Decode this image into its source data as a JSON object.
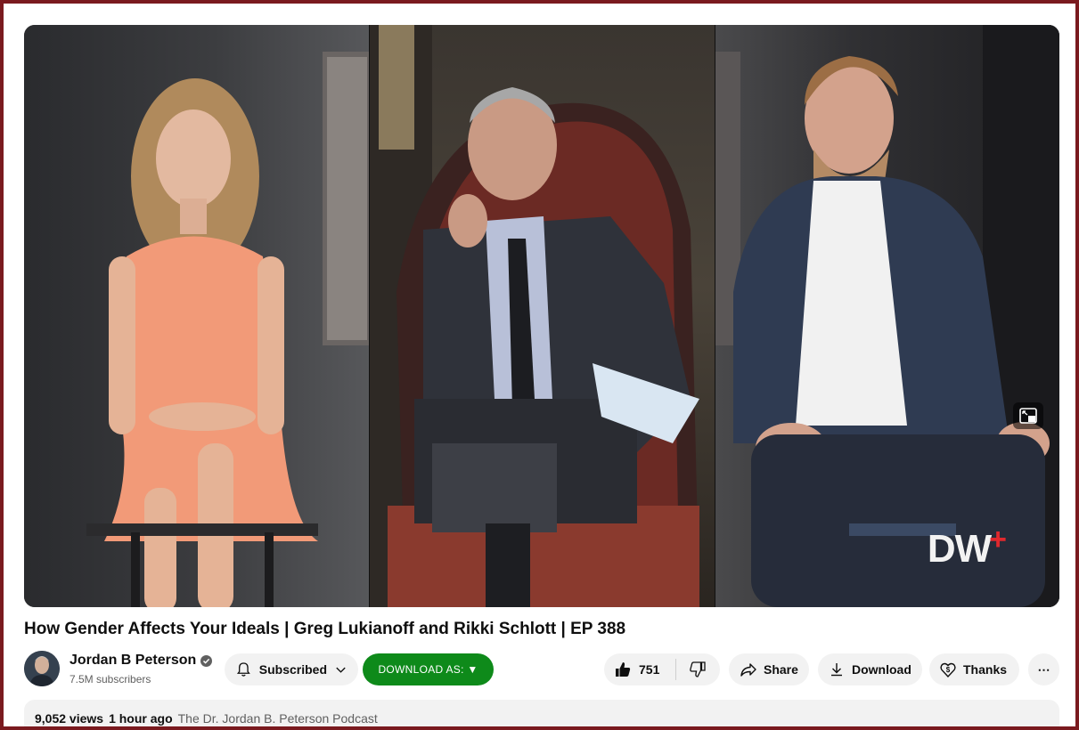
{
  "video": {
    "title": "How Gender Affects Your Ideals | Greg Lukianoff and Rikki Schlott | EP 388",
    "watermark_main": "DW",
    "watermark_accent": "+"
  },
  "channel": {
    "name": "Jordan B Peterson",
    "subscribers": "7.5M subscribers",
    "verified_icon": "verified-check-icon"
  },
  "actions": {
    "subscribed_label": "Subscribed",
    "download_as_label": "DOWNLOAD AS: ▼",
    "like_count": "751",
    "share_label": "Share",
    "download_label": "Download",
    "thanks_label": "Thanks",
    "more_label": "⋯"
  },
  "description": {
    "views": "9,052 views",
    "time": "1 hour ago",
    "playlist": "The Dr. Jordan B. Peterson Podcast"
  },
  "colors": {
    "page_border": "#7a1a1f",
    "download_as_bg": "#0e8a1a",
    "pill_bg": "#f2f2f2",
    "dw_accent": "#e0282d"
  }
}
